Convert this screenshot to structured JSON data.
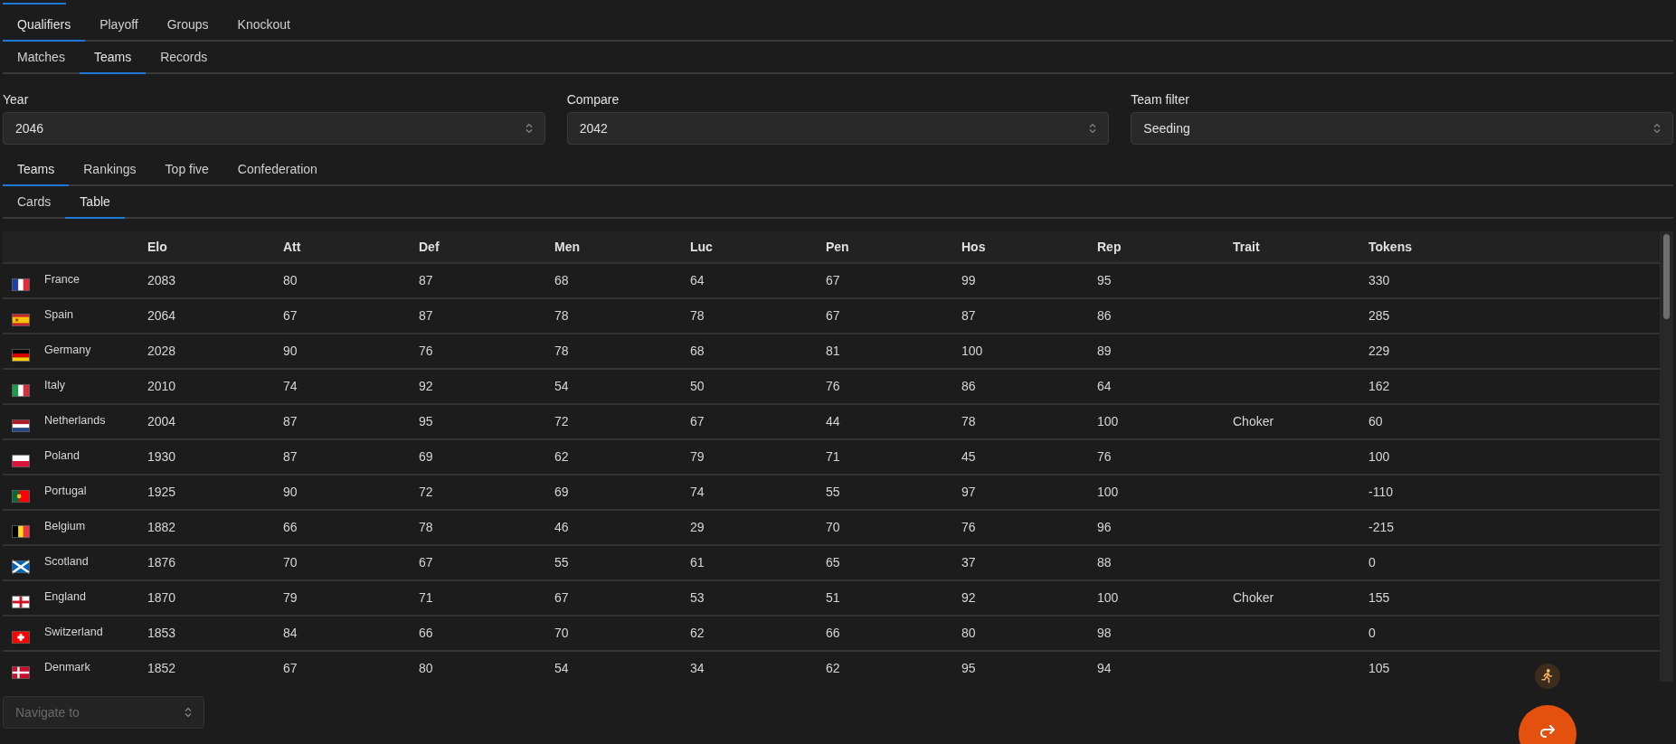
{
  "tab_levels": [
    [
      {
        "label": "Qualifiers",
        "selected": true
      },
      {
        "label": "Playoff",
        "selected": false
      },
      {
        "label": "Groups",
        "selected": false
      },
      {
        "label": "Knockout",
        "selected": false
      }
    ],
    [
      {
        "label": "Matches",
        "selected": false
      },
      {
        "label": "Teams",
        "selected": true
      },
      {
        "label": "Records",
        "selected": false
      }
    ]
  ],
  "filters": [
    {
      "label": "Year",
      "value": "2046"
    },
    {
      "label": "Compare",
      "value": "2042"
    },
    {
      "label": "Team filter",
      "value": "Seeding"
    }
  ],
  "view_tabs": [
    [
      {
        "label": "Teams",
        "selected": true
      },
      {
        "label": "Rankings",
        "selected": false
      },
      {
        "label": "Top five",
        "selected": false
      },
      {
        "label": "Confederation",
        "selected": false
      }
    ],
    [
      {
        "label": "Cards",
        "selected": false
      },
      {
        "label": "Table",
        "selected": true
      }
    ]
  ],
  "table": {
    "columns": [
      "Elo",
      "Att",
      "Def",
      "Men",
      "Luc",
      "Pen",
      "Hos",
      "Rep",
      "Trait",
      "Tokens"
    ],
    "rows": [
      {
        "kind": "fr",
        "team": "France",
        "cells": [
          "2083",
          "80",
          "87",
          "68",
          "64",
          "67",
          "99",
          "95",
          "",
          "330"
        ]
      },
      {
        "kind": "es",
        "team": "Spain",
        "cells": [
          "2064",
          "67",
          "87",
          "78",
          "78",
          "67",
          "87",
          "86",
          "",
          "285"
        ]
      },
      {
        "kind": "de",
        "team": "Germany",
        "cells": [
          "2028",
          "90",
          "76",
          "78",
          "68",
          "81",
          "100",
          "89",
          "",
          "229"
        ]
      },
      {
        "kind": "it",
        "team": "Italy",
        "cells": [
          "2010",
          "74",
          "92",
          "54",
          "50",
          "76",
          "86",
          "64",
          "",
          "162"
        ]
      },
      {
        "kind": "nl",
        "team": "Netherlands",
        "cells": [
          "2004",
          "87",
          "95",
          "72",
          "67",
          "44",
          "78",
          "100",
          "Choker",
          "60"
        ]
      },
      {
        "kind": "pl",
        "team": "Poland",
        "cells": [
          "1930",
          "87",
          "69",
          "62",
          "79",
          "71",
          "45",
          "76",
          "",
          "100"
        ]
      },
      {
        "kind": "pt",
        "team": "Portugal",
        "cells": [
          "1925",
          "90",
          "72",
          "69",
          "74",
          "55",
          "97",
          "100",
          "",
          "-110"
        ]
      },
      {
        "kind": "be",
        "team": "Belgium",
        "cells": [
          "1882",
          "66",
          "78",
          "46",
          "29",
          "70",
          "76",
          "96",
          "",
          "-215"
        ]
      },
      {
        "kind": "sco",
        "team": "Scotland",
        "cells": [
          "1876",
          "70",
          "67",
          "55",
          "61",
          "65",
          "37",
          "88",
          "",
          "0"
        ]
      },
      {
        "kind": "eng",
        "team": "England",
        "cells": [
          "1870",
          "79",
          "71",
          "67",
          "53",
          "51",
          "92",
          "100",
          "Choker",
          "155"
        ]
      },
      {
        "kind": "ch",
        "team": "Switzerland",
        "cells": [
          "1853",
          "84",
          "66",
          "70",
          "62",
          "66",
          "80",
          "98",
          "",
          "0"
        ]
      },
      {
        "kind": "dk",
        "team": "Denmark",
        "cells": [
          "1852",
          "67",
          "80",
          "54",
          "34",
          "62",
          "95",
          "94",
          "",
          "105"
        ]
      }
    ]
  },
  "navigate": {
    "placeholder": "Navigate to"
  }
}
